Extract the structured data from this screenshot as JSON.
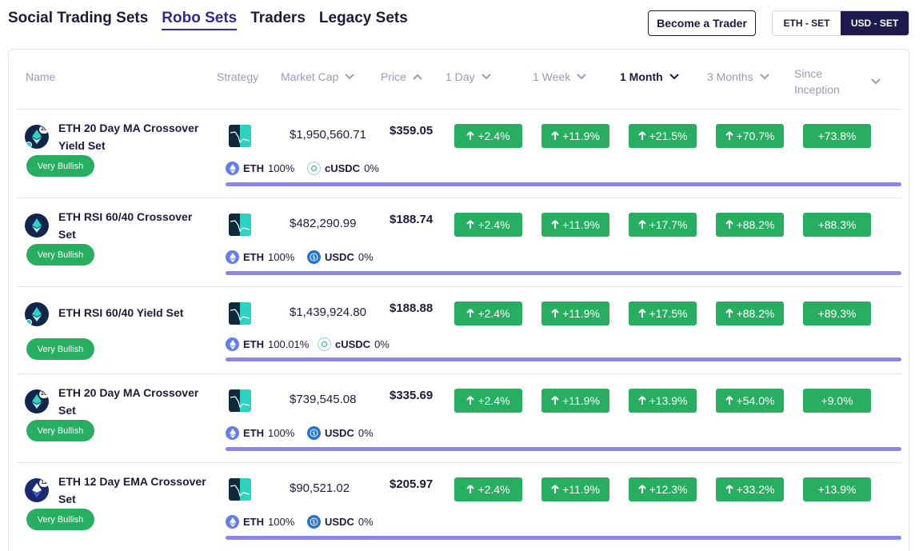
{
  "nav": {
    "tabs": [
      {
        "label": "Social Trading Sets"
      },
      {
        "label": "Robo Sets"
      },
      {
        "label": "Traders"
      },
      {
        "label": "Legacy Sets"
      }
    ],
    "active": "Robo Sets"
  },
  "become_trader_label": "Become a Trader",
  "currency_toggle": {
    "options": [
      "ETH - SET",
      "USD - SET"
    ],
    "selected": "USD - SET"
  },
  "table": {
    "headers": {
      "name": "Name",
      "strategy": "Strategy",
      "market_cap": "Market Cap",
      "price": "Price",
      "day": "1 Day",
      "week": "1 Week",
      "month": "1 Month",
      "months3": "3 Months",
      "inception": "Since Inception"
    },
    "rows": [
      {
        "name": "ETH 20 Day MA Crossover Yield Set",
        "icon_badge": "20",
        "sentiment": "Very Bullish",
        "market_cap": "$1,950,560.71",
        "price": "$359.05",
        "day": "+2.4%",
        "week": "+11.9%",
        "month": "+21.5%",
        "months3": "+70.7%",
        "inception": "+73.8%",
        "alloc1": {
          "sym": "ETH",
          "pct": "100%"
        },
        "alloc2": {
          "sym": "cUSDC",
          "pct": "0%"
        }
      },
      {
        "name": "ETH RSI 60/40 Crossover Set",
        "icon_badge": "",
        "sentiment": "Very Bullish",
        "market_cap": "$482,290.99",
        "price": "$188.74",
        "day": "+2.4%",
        "week": "+11.9%",
        "month": "+17.7%",
        "months3": "+88.2%",
        "inception": "+88.3%",
        "alloc1": {
          "sym": "ETH",
          "pct": "100%"
        },
        "alloc2": {
          "sym": "USDC",
          "pct": "0%"
        }
      },
      {
        "name": "ETH RSI 60/40 Yield Set",
        "icon_badge": "",
        "sentiment": "Very Bullish",
        "market_cap": "$1,439,924.80",
        "price": "$188.88",
        "day": "+2.4%",
        "week": "+11.9%",
        "month": "+17.5%",
        "months3": "+88.2%",
        "inception": "+89.3%",
        "alloc1": {
          "sym": "ETH",
          "pct": "100.01%"
        },
        "alloc2": {
          "sym": "cUSDC",
          "pct": "0%"
        }
      },
      {
        "name": "ETH 20 Day MA Crossover Set",
        "icon_badge": "20",
        "sentiment": "Very Bullish",
        "market_cap": "$739,545.08",
        "price": "$335.69",
        "day": "+2.4%",
        "week": "+11.9%",
        "month": "+13.9%",
        "months3": "+54.0%",
        "inception": "+9.0%",
        "alloc1": {
          "sym": "ETH",
          "pct": "100%"
        },
        "alloc2": {
          "sym": "USDC",
          "pct": "0%"
        }
      },
      {
        "name": "ETH 12 Day EMA Crossover Set",
        "icon_badge": "12",
        "sentiment": "Very Bullish",
        "market_cap": "$90,521.02",
        "price": "$205.97",
        "day": "+2.4%",
        "week": "+11.9%",
        "month": "+12.3%",
        "months3": "+33.2%",
        "inception": "+13.9%",
        "alloc1": {
          "sym": "ETH",
          "pct": "100%"
        },
        "alloc2": {
          "sym": "USDC",
          "pct": "0%"
        }
      }
    ]
  },
  "colors": {
    "positive": "#27ae60",
    "accent": "#2f2a8c",
    "allocation_bar": "#8b86e6",
    "eth": "#627eea",
    "usdc": "#2775ca"
  }
}
